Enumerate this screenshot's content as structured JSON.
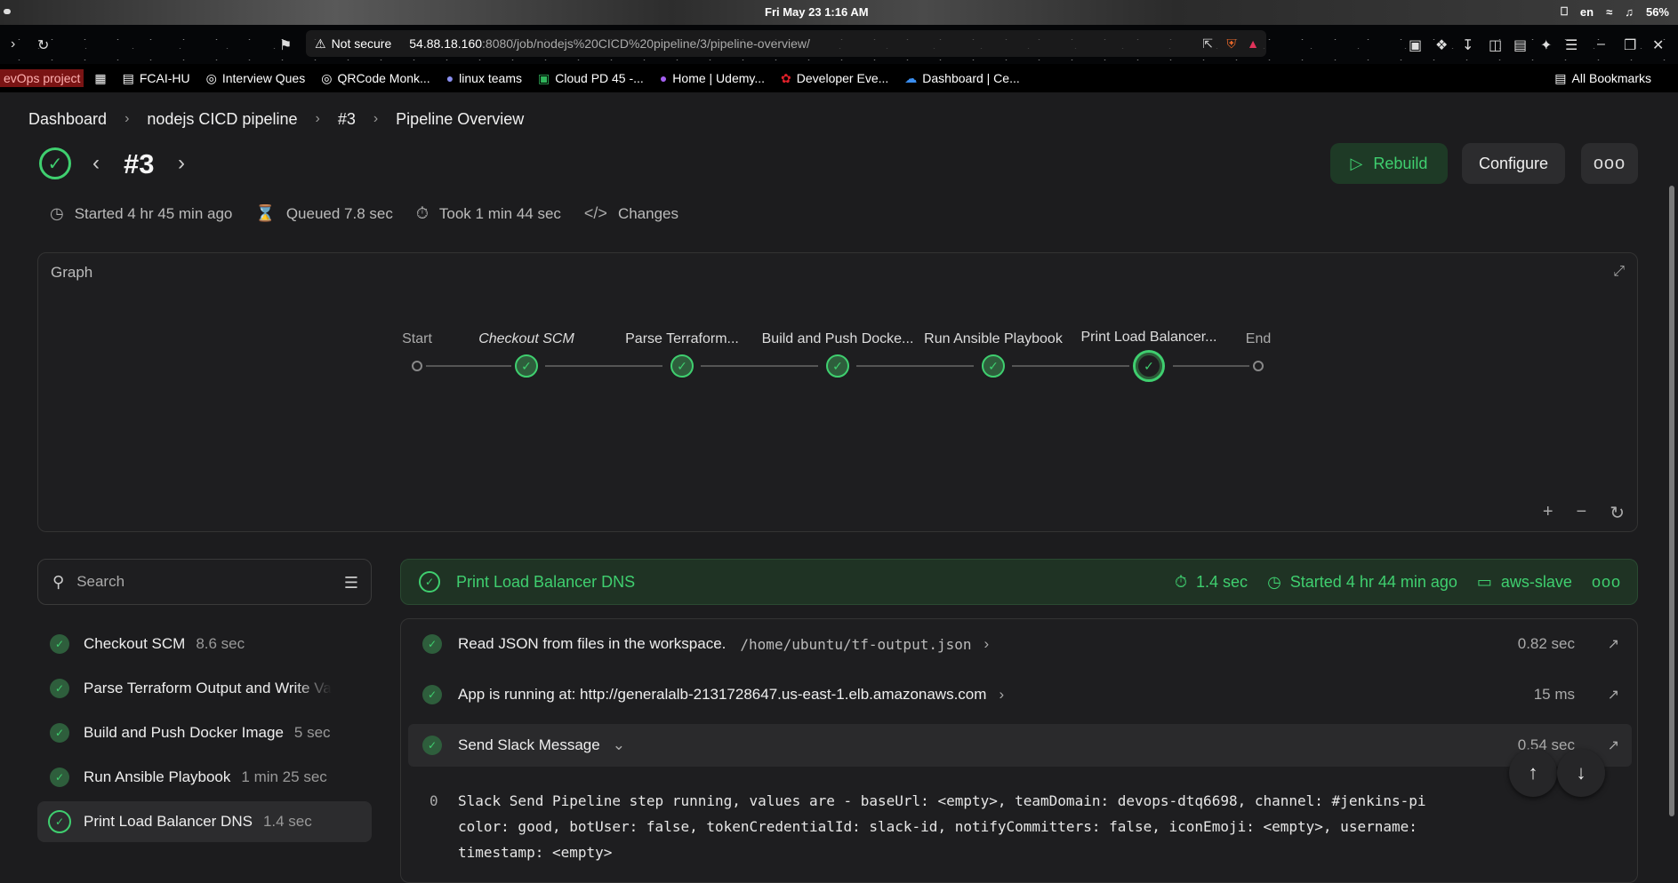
{
  "os": {
    "clock": "Fri May 23   1:16 AM",
    "lang": "en",
    "battery": "56%"
  },
  "browser": {
    "not_secure": "Not secure",
    "host": "54.88.18.160",
    "path": ":8080/job/nodejs%20CICD%20pipeline/3/pipeline-overview/"
  },
  "bookmarks": {
    "items": [
      "evOps project",
      "FCAI-HU",
      "Interview Ques",
      "QRCode Monk...",
      "linux teams",
      "Cloud PD 45 -...",
      "Home | Udemy...",
      "Developer Eve...",
      "Dashboard | Ce..."
    ],
    "all": "All Bookmarks"
  },
  "breadcrumb": [
    "Dashboard",
    "nodejs CICD pipeline",
    "#3",
    "Pipeline Overview"
  ],
  "run": {
    "title": "#3",
    "rebuild": "Rebuild",
    "configure": "Configure",
    "more": "ooo"
  },
  "meta": {
    "started": "Started 4 hr 45 min ago",
    "queued": "Queued 7.8 sec",
    "took": "Took 1 min 44 sec",
    "changes": "Changes"
  },
  "graph": {
    "title": "Graph",
    "start": "Start",
    "end": "End",
    "stages": [
      "Checkout SCM",
      "Parse Terraform...",
      "Build and Push Docke...",
      "Run Ansible Playbook",
      "Print Load Balancer..."
    ]
  },
  "search": {
    "placeholder": "Search"
  },
  "stage_list": [
    {
      "name": "Checkout SCM",
      "duration": "8.6 sec"
    },
    {
      "name": "Parse Terraform Output and Write Va",
      "duration": ""
    },
    {
      "name": "Build and Push Docker Image",
      "duration": "5 sec"
    },
    {
      "name": "Run Ansible Playbook",
      "duration": "1 min 25 sec"
    },
    {
      "name": "Print Load Balancer DNS",
      "duration": "1.4 sec"
    }
  ],
  "detail": {
    "stage": "Print Load Balancer DNS",
    "duration": "1.4 sec",
    "started": "Started 4 hr 44 min ago",
    "agent": "aws-slave",
    "steps": [
      {
        "label": "Read JSON from files in the workspace.",
        "arg": "/home/ubuntu/tf-output.json",
        "time": "0.82 sec"
      },
      {
        "label": "App is running at: http://generalalb-2131728647.us-east-1.elb.amazonaws.com",
        "arg": "",
        "time": "15 ms"
      },
      {
        "label": "Send Slack Message",
        "arg": "",
        "time": "0.54 sec"
      }
    ],
    "log_line_no": "0",
    "log": [
      "Slack Send Pipeline step running, values are - baseUrl: <empty>, teamDomain: devops-dtq6698, channel: #jenkins-pi",
      "color: good, botUser: false, tokenCredentialId: slack-id, notifyCommitters: false, iconEmoji: <empty>, username:",
      "timestamp: <empty>"
    ]
  }
}
